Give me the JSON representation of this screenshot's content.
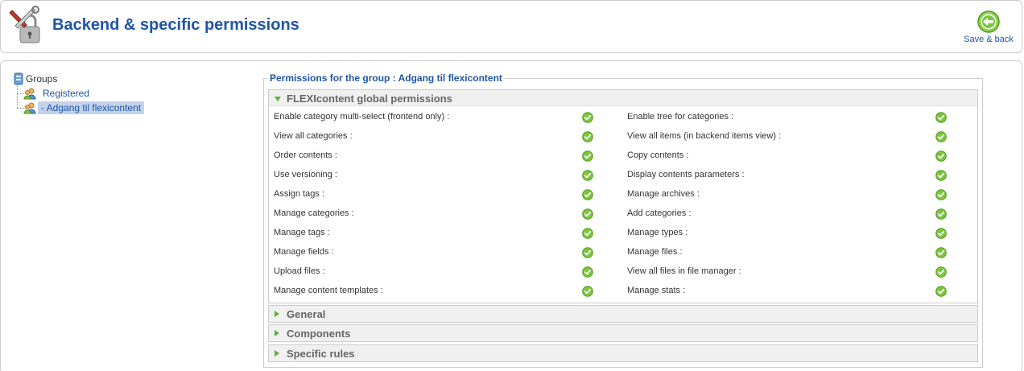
{
  "header": {
    "title": "Backend & specific permissions",
    "icon": "tools-lock-icon",
    "save_back_label": "Save & back",
    "save_back_icon": "arrow-left-circle-icon"
  },
  "tree": {
    "root_label": "Groups",
    "items": [
      {
        "label": "Registered"
      },
      {
        "label": "- Adgang til flexicontent"
      }
    ]
  },
  "permissions": {
    "legend": "Permissions for the group : Adgang til flexicontent",
    "global_panel_title": "FLEXIcontent global permissions",
    "rows": [
      {
        "left": "Enable category multi-select (frontend only) :",
        "right": "Enable tree for categories :"
      },
      {
        "left": "View all categories :",
        "right": "View all items (in backend items view) :"
      },
      {
        "left": "Order contents :",
        "right": "Copy contents :"
      },
      {
        "left": "Use versioning :",
        "right": "Display contents parameters :"
      },
      {
        "left": "Assign tags :",
        "right": "Manage archives :"
      },
      {
        "left": "Manage categories :",
        "right": "Add categories :"
      },
      {
        "left": "Manage tags :",
        "right": "Manage types :"
      },
      {
        "left": "Manage fields :",
        "right": "Manage files :"
      },
      {
        "left": "Upload files :",
        "right": "View all files in file manager :"
      },
      {
        "left": "Manage content templates :",
        "right": "Manage stats :"
      }
    ],
    "collapsed_panels": [
      "General",
      "Components",
      "Specific rules"
    ]
  },
  "colors": {
    "title_blue": "#1f55a6",
    "check_green": "#5fb13e",
    "selected_bg": "#c3d3ea"
  }
}
